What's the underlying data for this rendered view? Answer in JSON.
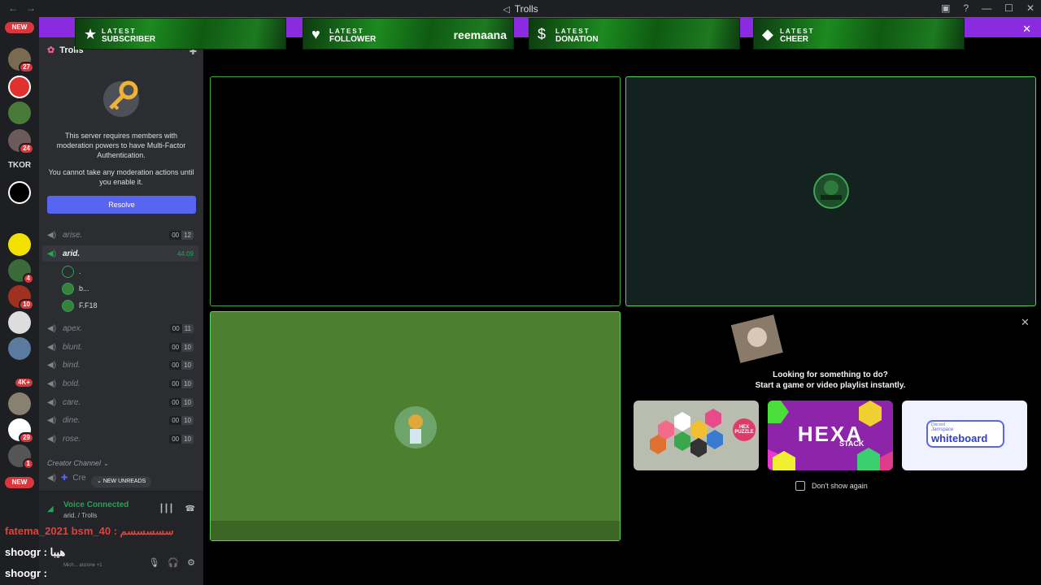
{
  "window": {
    "title": "Trolls"
  },
  "rail": {
    "new_top": "NEW",
    "new_bottom": "NEW",
    "tkor": "TKOR",
    "badges": [
      "27",
      "24",
      "4",
      "10",
      "4K+",
      "29",
      "1"
    ]
  },
  "server": {
    "name": "Trolls",
    "mfa_line1": "This server requires members with moderation powers to have Multi-Factor Authentication.",
    "mfa_line2": "You cannot take any moderation actions until you enable it.",
    "resolve": "Resolve"
  },
  "voice_channels": [
    {
      "name": "arise.",
      "a": "00",
      "b": "12"
    },
    {
      "name": "arid.",
      "timer": "44:09"
    },
    {
      "name": "apex.",
      "a": "00",
      "b": "11"
    },
    {
      "name": "blunt.",
      "a": "00",
      "b": "10"
    },
    {
      "name": "bind.",
      "a": "00",
      "b": "10"
    },
    {
      "name": "bold.",
      "a": "00",
      "b": "10"
    },
    {
      "name": "care.",
      "a": "00",
      "b": "10"
    },
    {
      "name": "dine.",
      "a": "00",
      "b": "10"
    },
    {
      "name": "rose.",
      "a": "00",
      "b": "10"
    }
  ],
  "members": [
    ".",
    "b...",
    "F.F18"
  ],
  "category": "Creator Channel",
  "create_channel": "Cre",
  "new_unreads": "NEW UNREADS",
  "voice_panel": {
    "title": "Voice Connected",
    "sub": "arid. / Trolls"
  },
  "user_panel": {
    "name": "Mich... anzone +1"
  },
  "chat": [
    {
      "text": "fatema_2021 bsm_40 : سسسسسم"
    },
    {
      "text": "shoogr : هيبا"
    },
    {
      "text": "shoogr :"
    }
  ],
  "alerts": [
    {
      "label1": "LATEST",
      "label2": "SUBSCRIBER",
      "value": ""
    },
    {
      "label1": "LATEST",
      "label2": "FOLLOWER",
      "value": "reemaana"
    },
    {
      "label1": "LATEST",
      "label2": "DONATION",
      "value": ""
    },
    {
      "label1": "LATEST",
      "label2": "CHEER",
      "value": ""
    }
  ],
  "activity": {
    "title": "Looking for something to do?",
    "subtitle": "Start a game or video playlist instantly.",
    "cards": [
      {
        "title": "HEX PUZZLE"
      },
      {
        "title": "HEXA",
        "sub": "STACK"
      },
      {
        "brand": "Discord",
        "title": "Jamspace",
        "sub": "whiteboard"
      }
    ],
    "dont_show": "Don't show again"
  },
  "colors": {
    "accent": "#5865f2",
    "voice_green": "#23a559",
    "alert_bar": "#8a2be2"
  }
}
